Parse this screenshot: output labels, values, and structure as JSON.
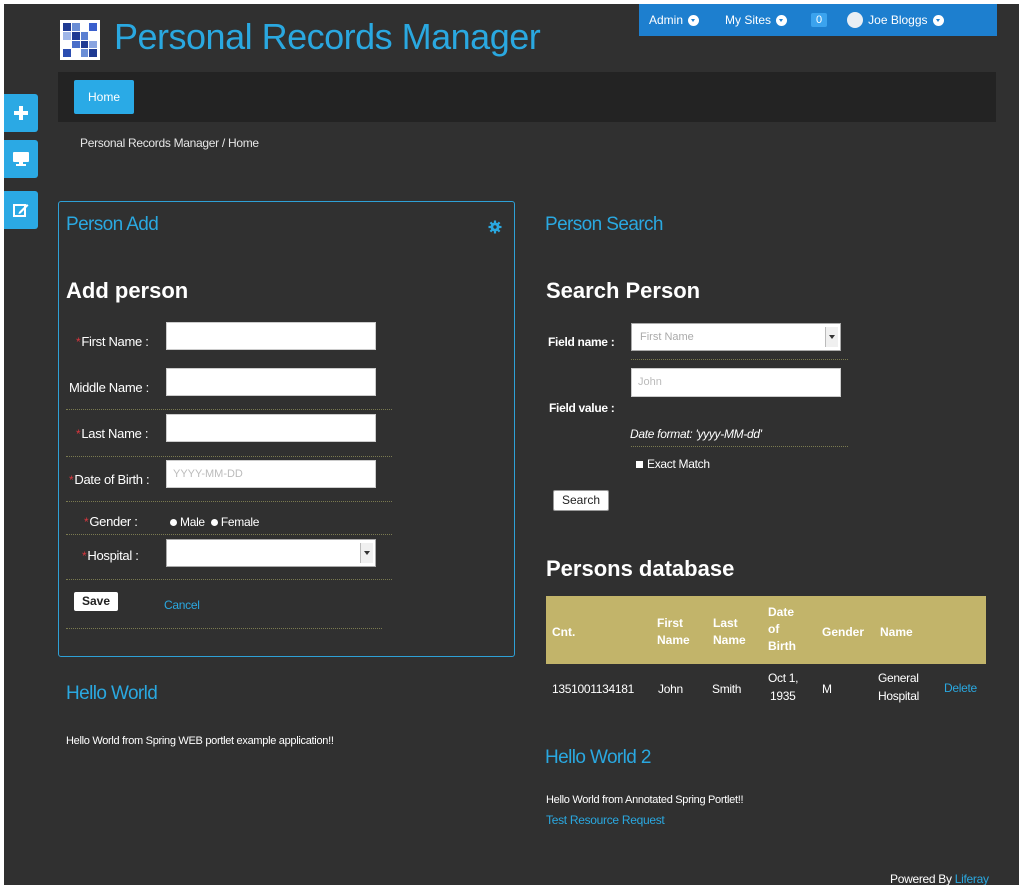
{
  "app": {
    "title": "Personal Records Manager"
  },
  "topbar": {
    "admin": "Admin",
    "my_sites": "My Sites",
    "notifications": "0",
    "user": "Joe Bloggs"
  },
  "nav": {
    "home": "Home"
  },
  "breadcrumb": "Personal Records Manager / Home",
  "dock": {
    "add_icon": "plus-icon",
    "preview_icon": "monitor-icon",
    "edit_icon": "edit-icon"
  },
  "person_add": {
    "portlet_title": "Person Add",
    "heading": "Add person",
    "required_mark": "*",
    "first_name_label": "First Name :",
    "middle_name_label": "Middle Name :",
    "last_name_label": "Last Name :",
    "dob_label": "Date of Birth :",
    "dob_placeholder": "YYYY-MM-DD",
    "gender_label": "Gender :",
    "gender_male": "Male",
    "gender_female": "Female",
    "hospital_label": "Hospital :",
    "hospital_value": "",
    "save": "Save",
    "cancel": "Cancel"
  },
  "person_search": {
    "portlet_title": "Person Search",
    "heading": "Search Person",
    "field_name_label": "Field name :",
    "field_name_value": "First Name",
    "field_value_label": "Field value :",
    "field_value_placeholder": "John",
    "date_format_hint": "Date format: 'yyyy-MM-dd'",
    "exact_match": "Exact Match",
    "search": "Search"
  },
  "persons_db": {
    "heading": "Persons database",
    "headers": {
      "cnt": "Cnt.",
      "first_1": "First",
      "first_2": "Name",
      "last_1": "Last",
      "last_2": "Name",
      "dob_1": "Date",
      "dob_2": "of",
      "dob_3": "Birth",
      "gender": "Gender",
      "name": "Name"
    },
    "row": {
      "cnt": "1351001134181",
      "first": "John",
      "last": "Smith",
      "dob_1": "Oct 1,",
      "dob_2": "1935",
      "gender": "M",
      "name_1": "General",
      "name_2": "Hospital",
      "action": "Delete"
    }
  },
  "hello1": {
    "title": "Hello World",
    "text": "Hello World from Spring WEB portlet example application!!"
  },
  "hello2": {
    "title": "Hello World 2",
    "text": "Hello World from Annotated Spring Portlet!!",
    "link": "Test Resource Request"
  },
  "footer": {
    "powered": "Powered By",
    "brand": "Liferay"
  },
  "colors": {
    "accent": "#2aa8e0",
    "topbar": "#1d7fcf",
    "table_head": "#c2b46a",
    "background": "#303030",
    "required": "#d9363e"
  }
}
